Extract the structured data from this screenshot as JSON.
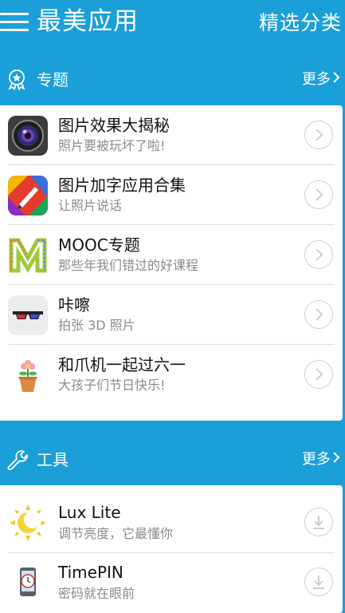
{
  "header": {
    "title": "最美应用",
    "right_label": "精选分类"
  },
  "topics": {
    "title": "专题",
    "more": "更多",
    "items": [
      {
        "title": "图片效果大揭秘",
        "subtitle": "照片要被玩坏了啦!",
        "icon": "camera-lens-icon"
      },
      {
        "title": "图片加字应用合集",
        "subtitle": "让照片说话",
        "icon": "pen-colorful-icon"
      },
      {
        "title": "MOOC专题",
        "subtitle": "那些年我们错过的好课程",
        "icon": "mooc-letter-icon"
      },
      {
        "title": "咔嚓",
        "subtitle": "拍张 3D 照片",
        "icon": "3d-glasses-icon"
      },
      {
        "title": "和爪机一起过六一",
        "subtitle": "大孩子们节日快乐!",
        "icon": "flower-pot-icon"
      }
    ]
  },
  "tools": {
    "title": "工具",
    "more": "更多",
    "items": [
      {
        "title": "Lux Lite",
        "subtitle": "调节亮度，它最懂你",
        "icon": "sun-moon-icon"
      },
      {
        "title": "TimePIN",
        "subtitle": "密码就在眼前",
        "icon": "phone-clock-icon"
      }
    ]
  },
  "colors": {
    "brand": "#1a9fd8",
    "card": "#ffffff",
    "subtitle": "#8a8a8a"
  }
}
